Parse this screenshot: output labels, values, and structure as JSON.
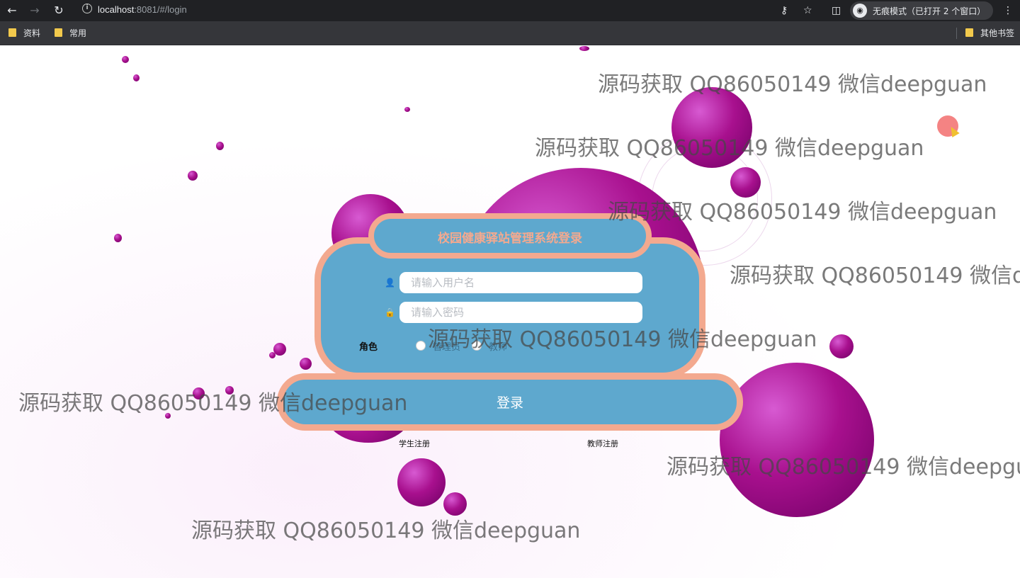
{
  "browser": {
    "url_host": "localhost",
    "url_rest": ":8081/#/login",
    "incognito_label": "无痕模式（已打开 2 个窗口）"
  },
  "bookmarks": {
    "items": [
      "资料",
      "常用"
    ],
    "other": "其他书签"
  },
  "login": {
    "title": "校园健康驿站管理系统登录",
    "username_placeholder": "请输入用户名",
    "password_placeholder": "请输入密码",
    "role_label": "角色",
    "role_options": [
      "管理员",
      "教师"
    ],
    "submit_label": "登录",
    "register_student": "学生注册",
    "register_teacher": "教师注册"
  },
  "watermark": "源码获取 QQ86050149 微信deepguan",
  "colors": {
    "form_fill": "#5ea8ce",
    "form_border": "#f3a98f",
    "bubble": "#a8108e"
  }
}
